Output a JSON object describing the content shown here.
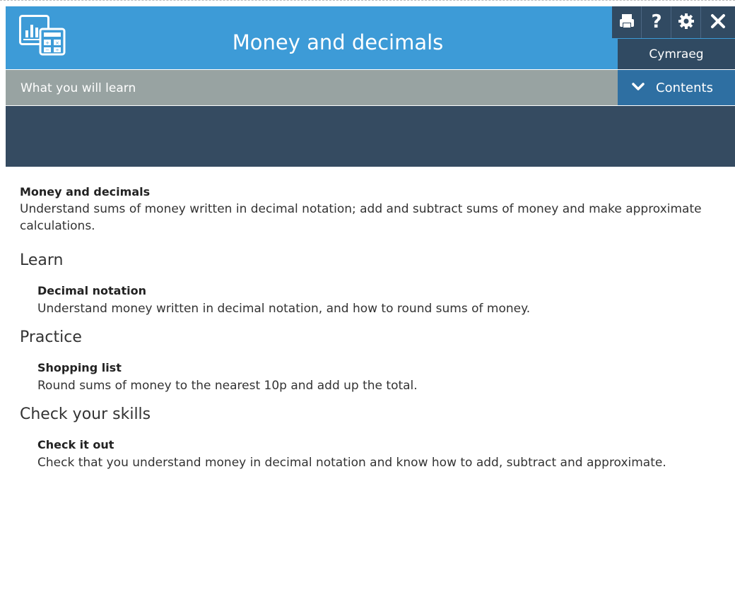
{
  "header": {
    "title": "Money and decimals",
    "logo_icon": "calculator-chart-icon",
    "tools": [
      {
        "name": "print-button",
        "icon": "print-icon"
      },
      {
        "name": "help-button",
        "icon": "question-icon"
      },
      {
        "name": "settings-button",
        "icon": "gear-icon"
      },
      {
        "name": "close-button",
        "icon": "close-icon"
      }
    ],
    "language_label": "Cymraeg"
  },
  "subbar": {
    "label": "What you will learn",
    "contents_label": "Contents"
  },
  "intro": {
    "title": "Money and decimals",
    "description": "Understand sums of money written in decimal notation; add and subtract sums of money and make approximate calculations."
  },
  "sections": [
    {
      "heading": "Learn",
      "item_title": "Decimal notation",
      "item_description": "Understand money written in decimal notation, and how to round sums of money."
    },
    {
      "heading": "Practice",
      "item_title": "Shopping list",
      "item_description": "Round sums of money to the nearest 10p and add up the total."
    },
    {
      "heading": "Check your skills",
      "item_title": "Check it out",
      "item_description": "Check that you understand money in decimal notation and know how to add, subtract and approximate."
    }
  ],
  "colors": {
    "header_blue": "#3d9bd7",
    "dark_navy": "#314a62",
    "subbar_grey": "#98a3a2",
    "contents_blue": "#2e6fa2",
    "banner": "#354b61"
  }
}
